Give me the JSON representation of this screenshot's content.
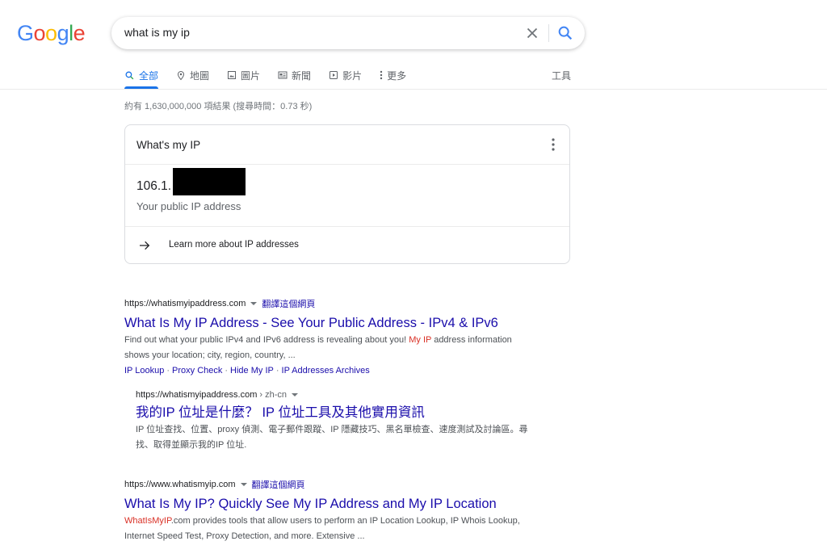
{
  "logo": {
    "letters": [
      "G",
      "o",
      "o",
      "g",
      "l",
      "e"
    ],
    "colors": [
      "#4285F4",
      "#EA4335",
      "#FBBC05",
      "#4285F4",
      "#34A853",
      "#EA4335"
    ]
  },
  "search": {
    "query": "what is my ip"
  },
  "tabs": [
    {
      "label": "全部",
      "icon": "search-icon",
      "active": true
    },
    {
      "label": "地圖",
      "icon": "map-pin-icon"
    },
    {
      "label": "圖片",
      "icon": "image-icon"
    },
    {
      "label": "新聞",
      "icon": "news-icon"
    },
    {
      "label": "影片",
      "icon": "video-icon"
    },
    {
      "label": "更多",
      "icon": "more-vert-icon"
    }
  ],
  "tools_label": "工具",
  "stats": "約有 1,630,000,000 項結果 (搜尋時間：0.73 秒)",
  "ip_card": {
    "title": "What's my IP",
    "ip_prefix": "106.1.",
    "ip_label": "Your public IP address",
    "learn_more": "Learn more about IP addresses"
  },
  "results": [
    {
      "url": "https://whatismyipaddress.com",
      "translate": "翻譯這個網頁",
      "title": "What Is My IP Address - See Your Public Address - IPv4 & IPv6",
      "snippet_pre": "Find out what your public IPv4 and IPv6 address is revealing about you! ",
      "snippet_hl": "My IP",
      "snippet_post": " address information shows your location; city, region, country, ...",
      "sitelinks": [
        "IP Lookup",
        "Proxy Check",
        "Hide My IP",
        "IP Addresses Archives"
      ]
    },
    {
      "url": "https://whatismyipaddress.com",
      "url_path": "› zh-cn",
      "title": "我的IP 位址是什麼？ IP 位址工具及其他實用資訊",
      "snippet": "IP 位址查找、位置、proxy 偵測、電子郵件跟蹤、IP 隱藏技巧、黑名單檢查、速度測試及討論區。尋找、取得並顯示我的IP 位址."
    },
    {
      "url": "https://www.whatismyip.com",
      "translate": "翻譯這個網頁",
      "title": "What Is My IP? Quickly See My IP Address and My IP Location",
      "snippet_hl": "WhatIsMyIP",
      "snippet_post": ".com provides tools that allow users to perform an IP Location Lookup, IP Whois Lookup, Internet Speed Test, Proxy Detection, and more. Extensive ..."
    }
  ]
}
